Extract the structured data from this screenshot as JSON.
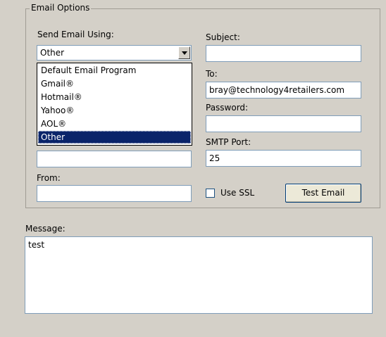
{
  "email_options": {
    "group_title": "Email Options",
    "send_using": {
      "label": "Send Email Using:",
      "selected": "Other",
      "options": [
        "Default Email Program",
        "Gmail®",
        "Hotmail®",
        "Yahoo®",
        "AOL®",
        "Other"
      ]
    },
    "subject": {
      "label": "Subject:",
      "value": ""
    },
    "to": {
      "label": "To:",
      "value": "bray@technology4retailers.com"
    },
    "password": {
      "label": "Password:",
      "value": ""
    },
    "smtp_port": {
      "label": "SMTP Port:",
      "value": "25"
    },
    "smtp_server": {
      "value": ""
    },
    "from": {
      "label": "From:",
      "value": ""
    },
    "use_ssl": {
      "label": "Use SSL",
      "checked": false
    },
    "test_button": "Test Email"
  },
  "message": {
    "label": "Message:",
    "value": "test"
  }
}
